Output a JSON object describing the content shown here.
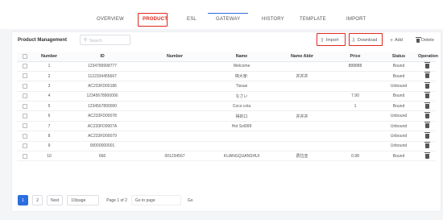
{
  "nav": {
    "tabs": [
      {
        "label": "OVERVIEW",
        "active": false
      },
      {
        "label": "PRODUCT",
        "active": true
      },
      {
        "label": "ESL",
        "active": false
      },
      {
        "label": "GATEWAY",
        "active": false
      },
      {
        "label": "HISTORY",
        "active": false
      },
      {
        "label": "TEMPLATE",
        "active": false
      },
      {
        "label": "IMPORT",
        "active": false
      }
    ]
  },
  "panel": {
    "title": "Product Management",
    "search_placeholder": "Search",
    "toolbar": {
      "import_label": "Import",
      "download_label": "Download",
      "add_label": "Add",
      "delete_label": "Delete"
    }
  },
  "table": {
    "headers": [
      "Number",
      "ID",
      "Number",
      "Name",
      "Name Abbr",
      "Price",
      "Status",
      "Operation"
    ],
    "rows": [
      [
        "1",
        "1234789998777",
        "",
        "Welcome",
        "",
        "888888",
        "Bound"
      ],
      [
        "2",
        "1122334455667",
        "",
        "锦大家:",
        "并并并",
        "",
        "Bound"
      ],
      [
        "3",
        "AC233FD00186",
        "",
        "Tissue",
        "",
        "",
        "Unbound"
      ],
      [
        "4",
        "12345678900000",
        "",
        "なさい",
        "",
        "7.90",
        "Bound"
      ],
      [
        "5",
        "1234567890000",
        "",
        "Coco cola",
        "",
        "1",
        "Bound"
      ],
      [
        "6",
        "AC233FD00078",
        "",
        "得的口",
        "并并并",
        "",
        "Unbound"
      ],
      [
        "7",
        "AC233FD0007A",
        "",
        "Hot Sol999",
        "",
        "",
        "Unbound"
      ],
      [
        "8",
        "AC233FD00079",
        "",
        "",
        "",
        "",
        "Unbound"
      ],
      [
        "9",
        "00000000001",
        "",
        "",
        "",
        "",
        "Unbound"
      ],
      [
        "10",
        "666",
        "001234567",
        "KUANGQUANSHUI",
        "费拉亚",
        "0.98",
        "Bound"
      ]
    ]
  },
  "pagination": {
    "pages": [
      "1",
      "2"
    ],
    "current": "1",
    "next_label": "Next",
    "page_size": "10/page",
    "page_info": "Page 1 of 2",
    "goto_label": "Go to page",
    "go_label": "Go"
  },
  "colors": {
    "accent": "#2b6ee0",
    "highlight": "#e0281e"
  }
}
